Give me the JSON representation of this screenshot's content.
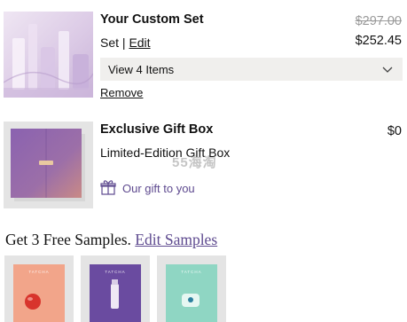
{
  "cart": {
    "custom_set": {
      "title": "Your Custom Set",
      "set_label": "Set",
      "separator": "|",
      "edit_label": "Edit",
      "original_price": "$297.00",
      "price": "$252.45",
      "view_items_label": "View 4 Items",
      "remove_label": "Remove"
    },
    "gift_box": {
      "title": "Exclusive Gift Box",
      "subtitle": "Limited-Edition Gift Box",
      "price": "$0",
      "gift_note": "Our gift to you"
    }
  },
  "samples": {
    "heading": "Get 3 Free Samples.",
    "edit_label": "Edit Samples",
    "items": [
      {
        "brand": "TATCHA",
        "color": "#f2a58a"
      },
      {
        "brand": "TATCHA",
        "color": "#6a4ba0"
      },
      {
        "brand": "TATCHA",
        "color": "#8fd6c3"
      }
    ]
  },
  "watermark": "55海淘",
  "colors": {
    "accent": "#5e4a8f",
    "bar_bg": "#f0efed"
  }
}
